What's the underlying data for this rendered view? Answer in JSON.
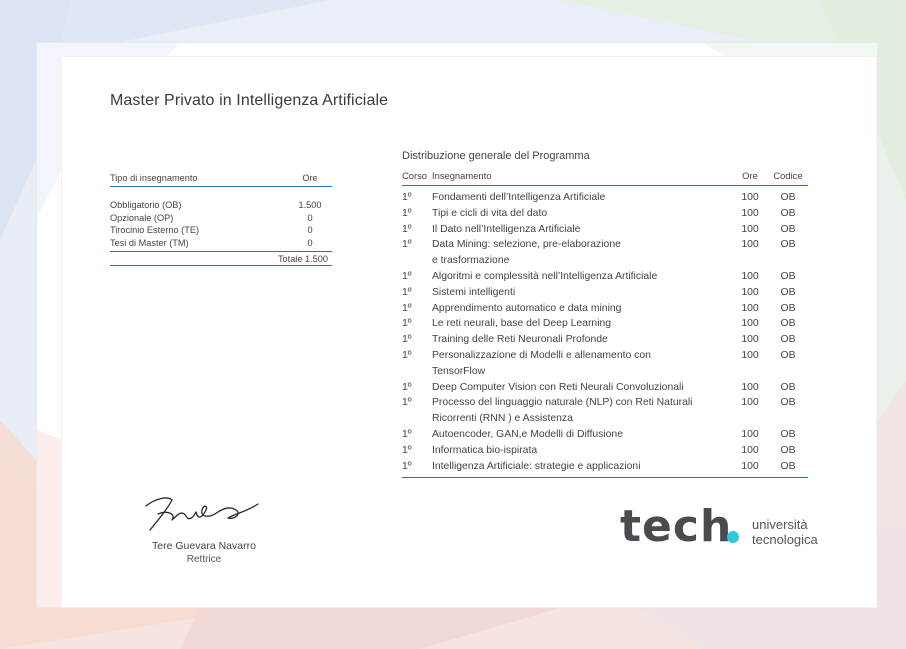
{
  "title": "Master Privato in Intelligenza Artificiale",
  "summary_table": {
    "header": {
      "tipo": "Tipo di insegnamento",
      "ore": "Ore"
    },
    "rows": [
      {
        "label": "Obbligatorio (OB)",
        "value": "1.500"
      },
      {
        "label": "Opzionale (OP)",
        "value": "0"
      },
      {
        "label": "Tirocinio Esterno (TE)",
        "value": "0"
      },
      {
        "label": "Tesi di Master (TM)",
        "value": "0"
      }
    ],
    "total": "Totale 1.500"
  },
  "program": {
    "title": "Distribuzione generale del Programma",
    "headers": {
      "corso": "Corso",
      "insegnamento": "Insegnamento",
      "ore": "Ore",
      "codice": "Codice"
    },
    "rows": [
      {
        "corso": "1º",
        "insegnamento": [
          "Fondamenti dell’Intelligenza Artificiale"
        ],
        "ore": "100",
        "codice": "OB"
      },
      {
        "corso": "1º",
        "insegnamento": [
          "Tipi e cicli di vita del dato"
        ],
        "ore": "100",
        "codice": "OB"
      },
      {
        "corso": "1º",
        "insegnamento": [
          "Il Dato nell’Intelligenza Artificiale"
        ],
        "ore": "100",
        "codice": "OB"
      },
      {
        "corso": "1º",
        "insegnamento": [
          "Data Mining: selezione, pre-elaborazione",
          "e trasformazione"
        ],
        "ore": "100",
        "codice": "OB"
      },
      {
        "corso": "1º",
        "insegnamento": [
          "Algoritmi e complessità nell’Intelligenza Artificiale"
        ],
        "ore": "100",
        "codice": "OB"
      },
      {
        "corso": "1º",
        "insegnamento": [
          "Sistemi intelligenti"
        ],
        "ore": "100",
        "codice": "OB"
      },
      {
        "corso": "1º",
        "insegnamento": [
          "Apprendimento automatico e data mining"
        ],
        "ore": "100",
        "codice": "OB"
      },
      {
        "corso": "1º",
        "insegnamento": [
          "Le reti neurali, base del Deep Learning"
        ],
        "ore": "100",
        "codice": "OB"
      },
      {
        "corso": "1º",
        "insegnamento": [
          "Training delle Reti Neuronali Profonde"
        ],
        "ore": "100",
        "codice": "OB"
      },
      {
        "corso": "1º",
        "insegnamento": [
          "Personalizzazione di Modelli e allenamento con",
          "TensorFlow"
        ],
        "ore": "100",
        "codice": "OB"
      },
      {
        "corso": "1º",
        "insegnamento": [
          "Deep Computer Vision con Reti Neurali Convoluzionali"
        ],
        "ore": "100",
        "codice": "OB"
      },
      {
        "corso": "1º",
        "insegnamento": [
          "Processo del linguaggio naturale (NLP) con Reti Naturali",
          "Ricorrenti (RNN ) e Assistenza"
        ],
        "ore": "100",
        "codice": "OB"
      },
      {
        "corso": "1º",
        "insegnamento": [
          "Autoencoder, GAN,e Modelli di Diffusione"
        ],
        "ore": "100",
        "codice": "OB"
      },
      {
        "corso": "1º",
        "insegnamento": [
          "Informatica bio-ispirata"
        ],
        "ore": "100",
        "codice": "OB"
      },
      {
        "corso": "1º",
        "insegnamento": [
          "Intelligenza Artificiale: strategie e applicazioni"
        ],
        "ore": "100",
        "codice": "OB"
      }
    ]
  },
  "signature": {
    "name": "Tere Guevara Navarro",
    "role": "Rettrice",
    "icon": "handwritten-signature"
  },
  "logo": {
    "word": "tech",
    "line1": "università",
    "line2": "tecnologica",
    "accent": "#2ec8dc"
  },
  "colors": {
    "rule": "#2f6db5",
    "text": "#444444"
  }
}
